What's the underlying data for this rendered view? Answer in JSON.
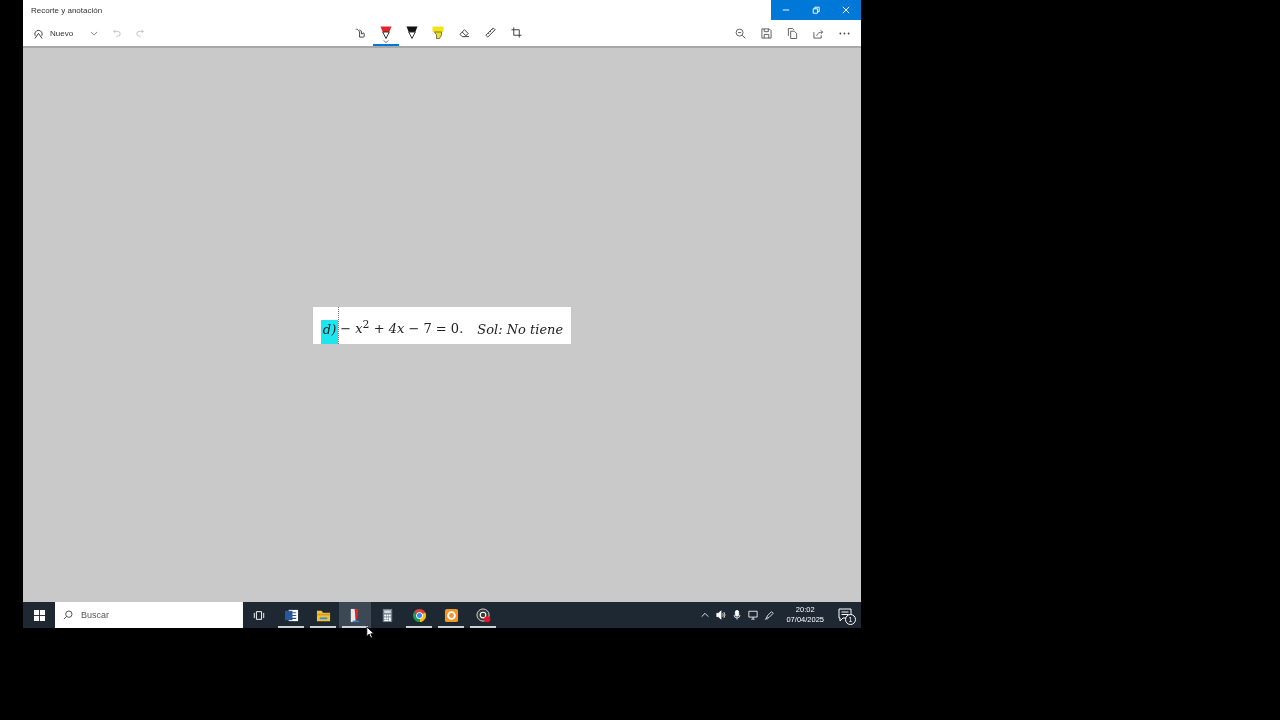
{
  "window": {
    "title": "Recorte y anotación"
  },
  "toolbar": {
    "new_button": {
      "label": "Nuevo"
    },
    "history": [
      {
        "kind": "undo",
        "disabled": true
      },
      {
        "kind": "redo",
        "disabled": true
      }
    ],
    "tools": [
      {
        "kind": "touch",
        "selected": false
      },
      {
        "kind": "ballpoint",
        "selected": true,
        "color": "#e3242b"
      },
      {
        "kind": "pencil",
        "selected": false,
        "color": "#111111"
      },
      {
        "kind": "highlighter",
        "selected": false,
        "color": "#f2e21c"
      },
      {
        "kind": "eraser",
        "selected": false
      },
      {
        "kind": "ruler",
        "selected": false
      },
      {
        "kind": "crop",
        "selected": false
      }
    ],
    "actions": [
      {
        "kind": "zoom-out"
      },
      {
        "kind": "save"
      },
      {
        "kind": "copy"
      },
      {
        "kind": "share"
      },
      {
        "kind": "more"
      }
    ]
  },
  "snip": {
    "label": "d)",
    "label_highlighted": true,
    "equation": "− *x*$^{2}$ + *4x* − 7 = 0.",
    "solution": "Sol: No tiene"
  },
  "taskbar": {
    "search": {
      "placeholder": "Buscar"
    },
    "apps": [
      {
        "kind": "document",
        "running": true,
        "selected": false
      },
      {
        "kind": "folder",
        "running": true,
        "selected": false
      },
      {
        "kind": "pen",
        "running": true,
        "selected": true
      },
      {
        "kind": "calculator",
        "running": false,
        "selected": false
      },
      {
        "kind": "browser",
        "running": true,
        "selected": false
      },
      {
        "kind": "ring",
        "running": true,
        "selected": false
      },
      {
        "kind": "record",
        "running": true,
        "selected": false
      }
    ],
    "tray": [
      {
        "kind": "chevron"
      },
      {
        "kind": "speaker"
      },
      {
        "kind": "microphone"
      },
      {
        "kind": "network"
      },
      {
        "kind": "pen"
      }
    ],
    "clock": {
      "time": "20:02",
      "date": "07/04/2025"
    },
    "notifications": {
      "count": "1"
    }
  }
}
